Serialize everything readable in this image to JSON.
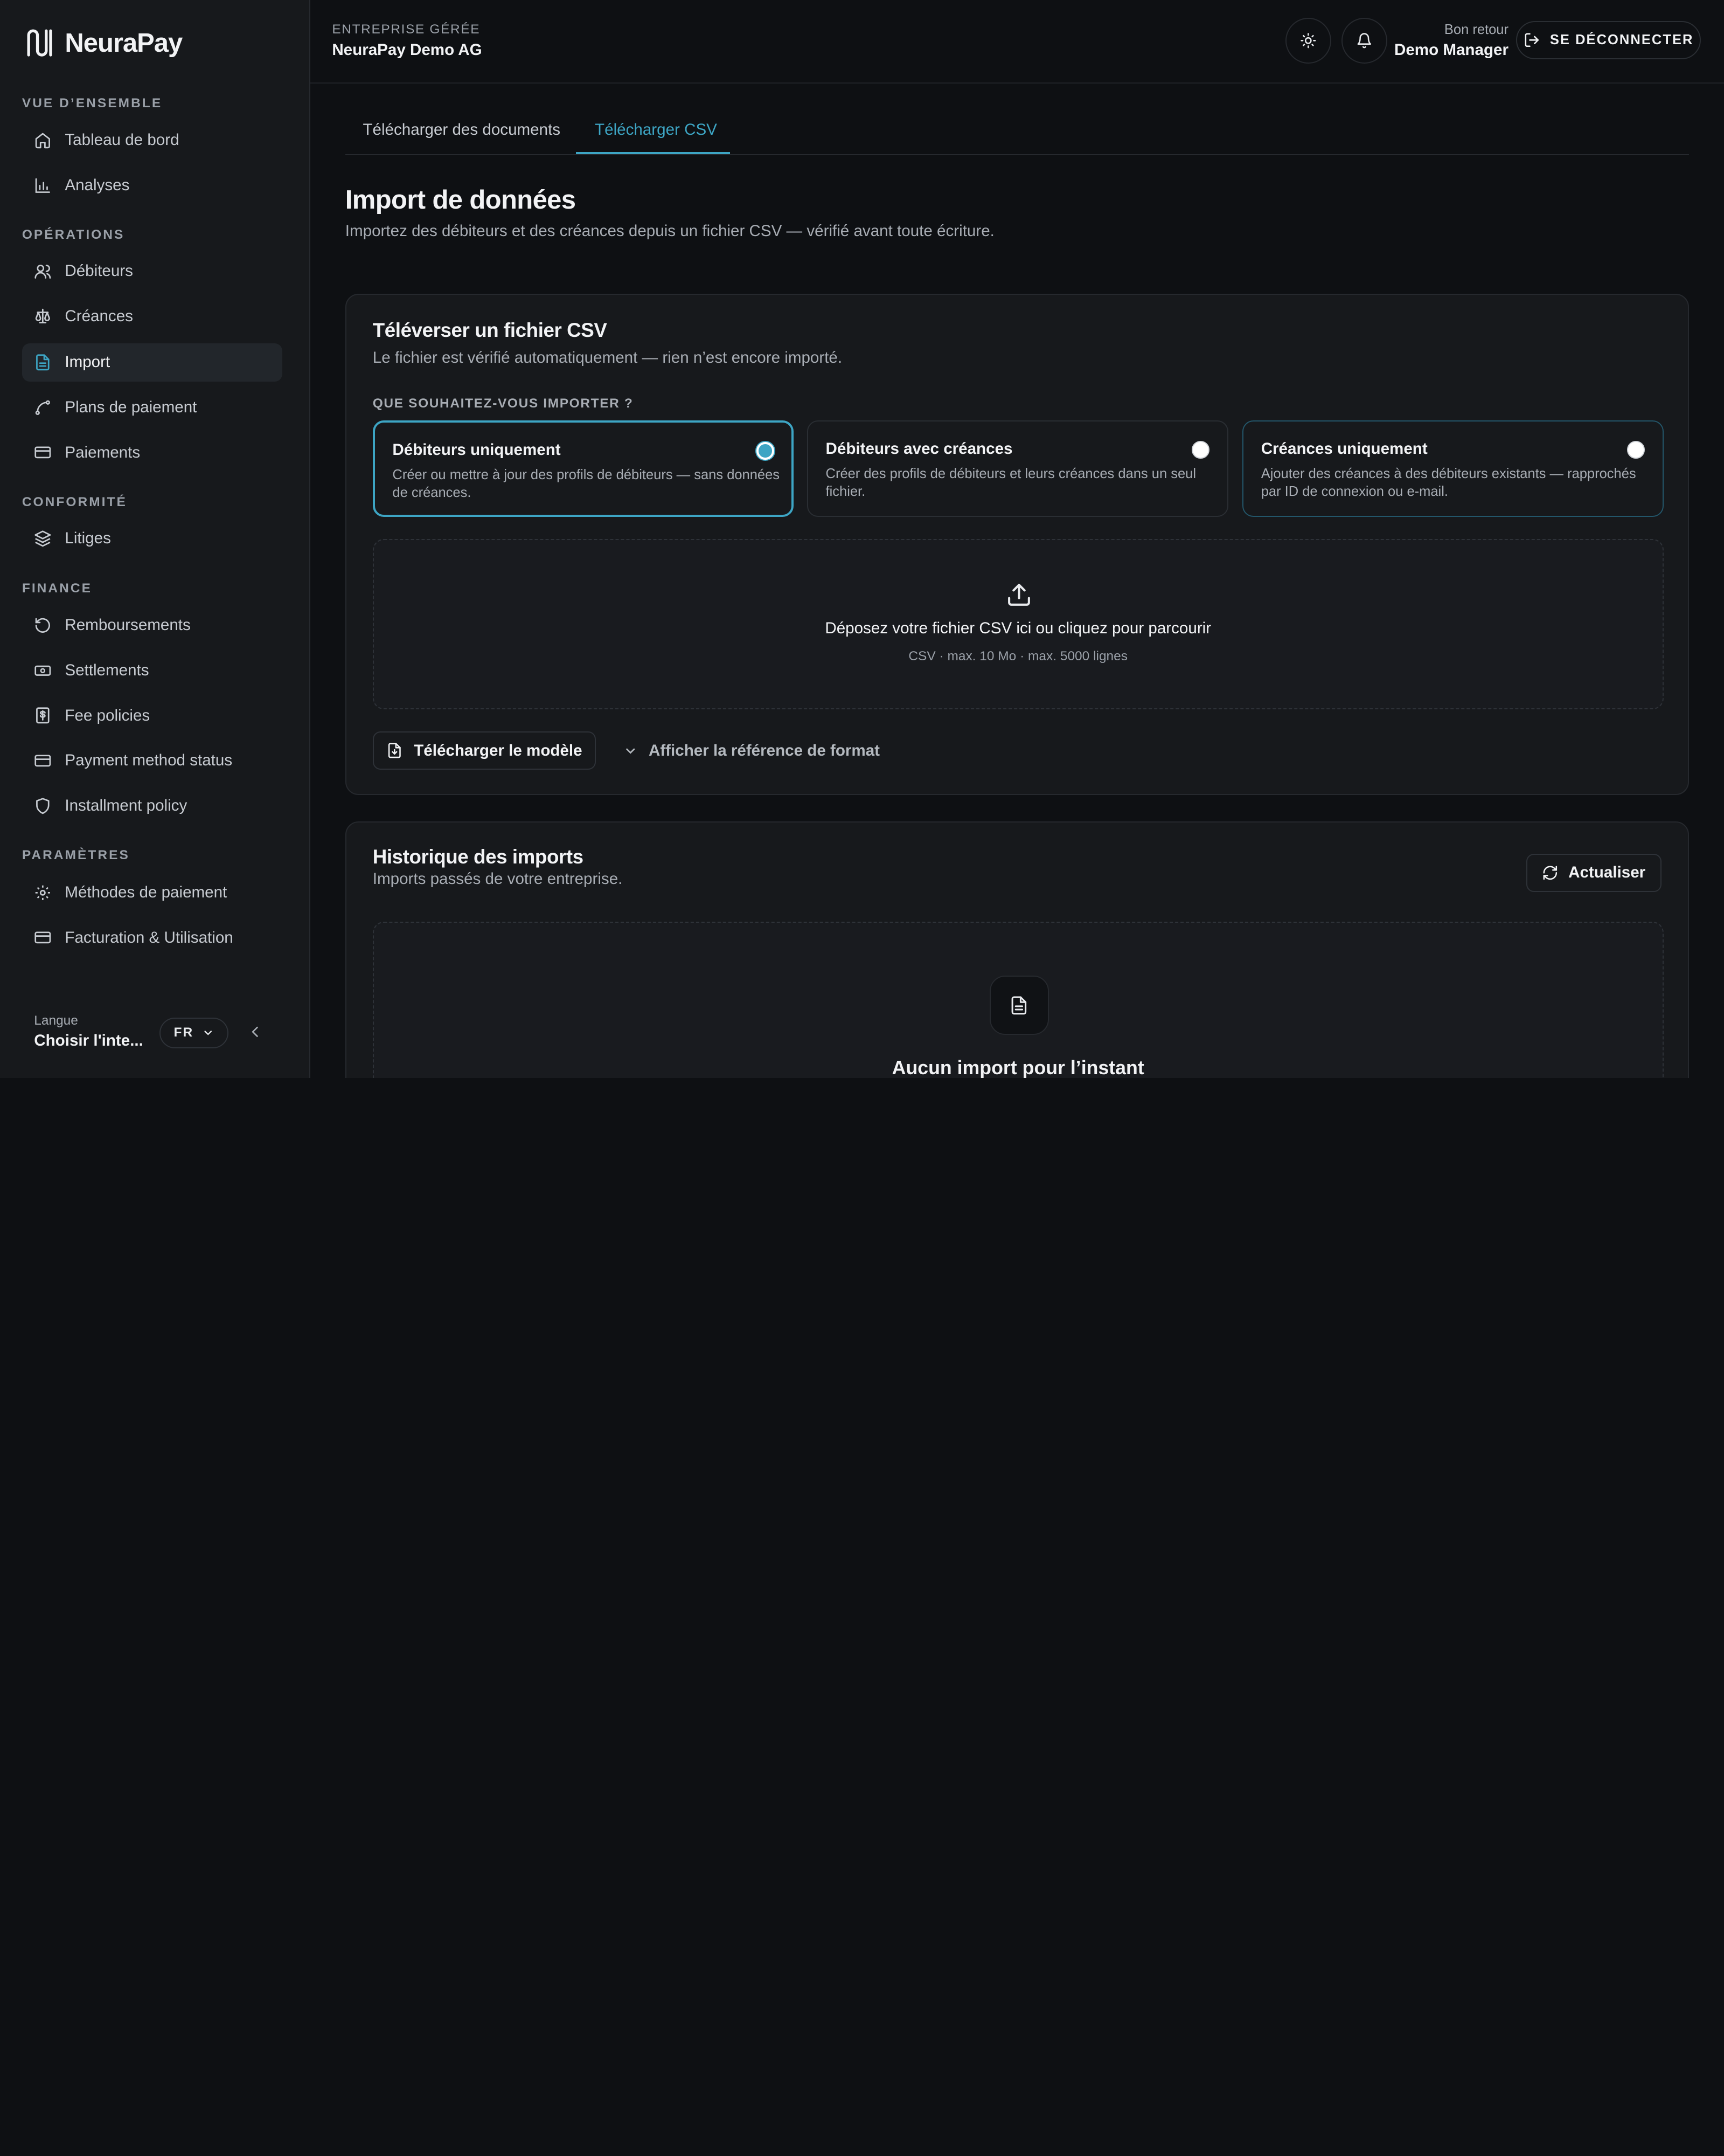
{
  "app": {
    "name": "NeuraPay"
  },
  "sidebar": {
    "sections": [
      {
        "title": "VUE D’ENSEMBLE",
        "items": [
          {
            "label": "Tableau de bord",
            "icon": "home-icon"
          },
          {
            "label": "Analyses",
            "icon": "bar-chart-icon"
          }
        ]
      },
      {
        "title": "OPÉRATIONS",
        "items": [
          {
            "label": "Débiteurs",
            "icon": "users-icon"
          },
          {
            "label": "Créances",
            "icon": "scale-icon"
          },
          {
            "label": "Import",
            "icon": "file-icon",
            "active": true
          },
          {
            "label": "Plans de paiement",
            "icon": "route-icon"
          },
          {
            "label": "Paiements",
            "icon": "card-icon"
          }
        ]
      },
      {
        "title": "CONFORMITÉ",
        "items": [
          {
            "label": "Litiges",
            "icon": "layers-icon"
          }
        ]
      },
      {
        "title": "FINANCE",
        "items": [
          {
            "label": "Remboursements",
            "icon": "rotate-ccw-icon"
          },
          {
            "label": "Settlements",
            "icon": "banknote-icon"
          },
          {
            "label": "Fee policies",
            "icon": "receipt-icon"
          },
          {
            "label": "Payment method status",
            "icon": "card-icon"
          },
          {
            "label": "Installment policy",
            "icon": "shield-icon"
          }
        ]
      },
      {
        "title": "PARAMÈTRES",
        "items": [
          {
            "label": "Méthodes de paiement",
            "icon": "gear-icon"
          },
          {
            "label": "Facturation & Utilisation",
            "icon": "card-icon"
          }
        ]
      }
    ],
    "language": {
      "label": "Langue",
      "value": "Choisir l'inte...",
      "code": "FR"
    }
  },
  "header": {
    "entreprise_label": "ENTREPRISE GÉRÉE",
    "entreprise_name": "NeuraPay Demo AG",
    "welcome": "Bon retour",
    "user": "Demo Manager",
    "logout": "SE DÉCONNECTER"
  },
  "tabs": [
    {
      "label": "Télécharger des documents"
    },
    {
      "label": "Télécharger CSV",
      "active": true
    }
  ],
  "page": {
    "title": "Import de données",
    "subtitle": "Importez des débiteurs et des créances depuis un fichier CSV — vérifié avant toute écriture."
  },
  "upload": {
    "title": "Téléverser un fichier CSV",
    "subtitle": "Le fichier est vérifié automatiquement — rien n’est encore importé.",
    "question": "QUE SOUHAITEZ-VOUS IMPORTER ?",
    "options": [
      {
        "title": "Débiteurs uniquement",
        "desc": "Créer ou mettre à jour des profils de débiteurs — sans données de créances.",
        "selected": true
      },
      {
        "title": "Débiteurs avec créances",
        "desc": "Créer des profils de débiteurs et leurs créances dans un seul fichier.",
        "selected": false
      },
      {
        "title": "Créances uniquement",
        "desc": "Ajouter des créances à des débiteurs existants — rapprochés par ID de connexion ou e-mail.",
        "selected": false
      }
    ],
    "drop_text": "Déposez votre fichier CSV ici ou cliquez pour parcourir",
    "drop_hint": "CSV · max. 10 Mo · max. 5000 lignes",
    "template_button": "Télécharger le modèle",
    "format_toggle": "Afficher la référence de format"
  },
  "history": {
    "title": "Historique des imports",
    "subtitle": "Imports passés de votre entreprise.",
    "refresh": "Actualiser",
    "empty": "Aucun import pour l’instant"
  },
  "colors": {
    "accent": "#3da5c4",
    "background": "#0e1013",
    "sidebar": "#17191c"
  }
}
